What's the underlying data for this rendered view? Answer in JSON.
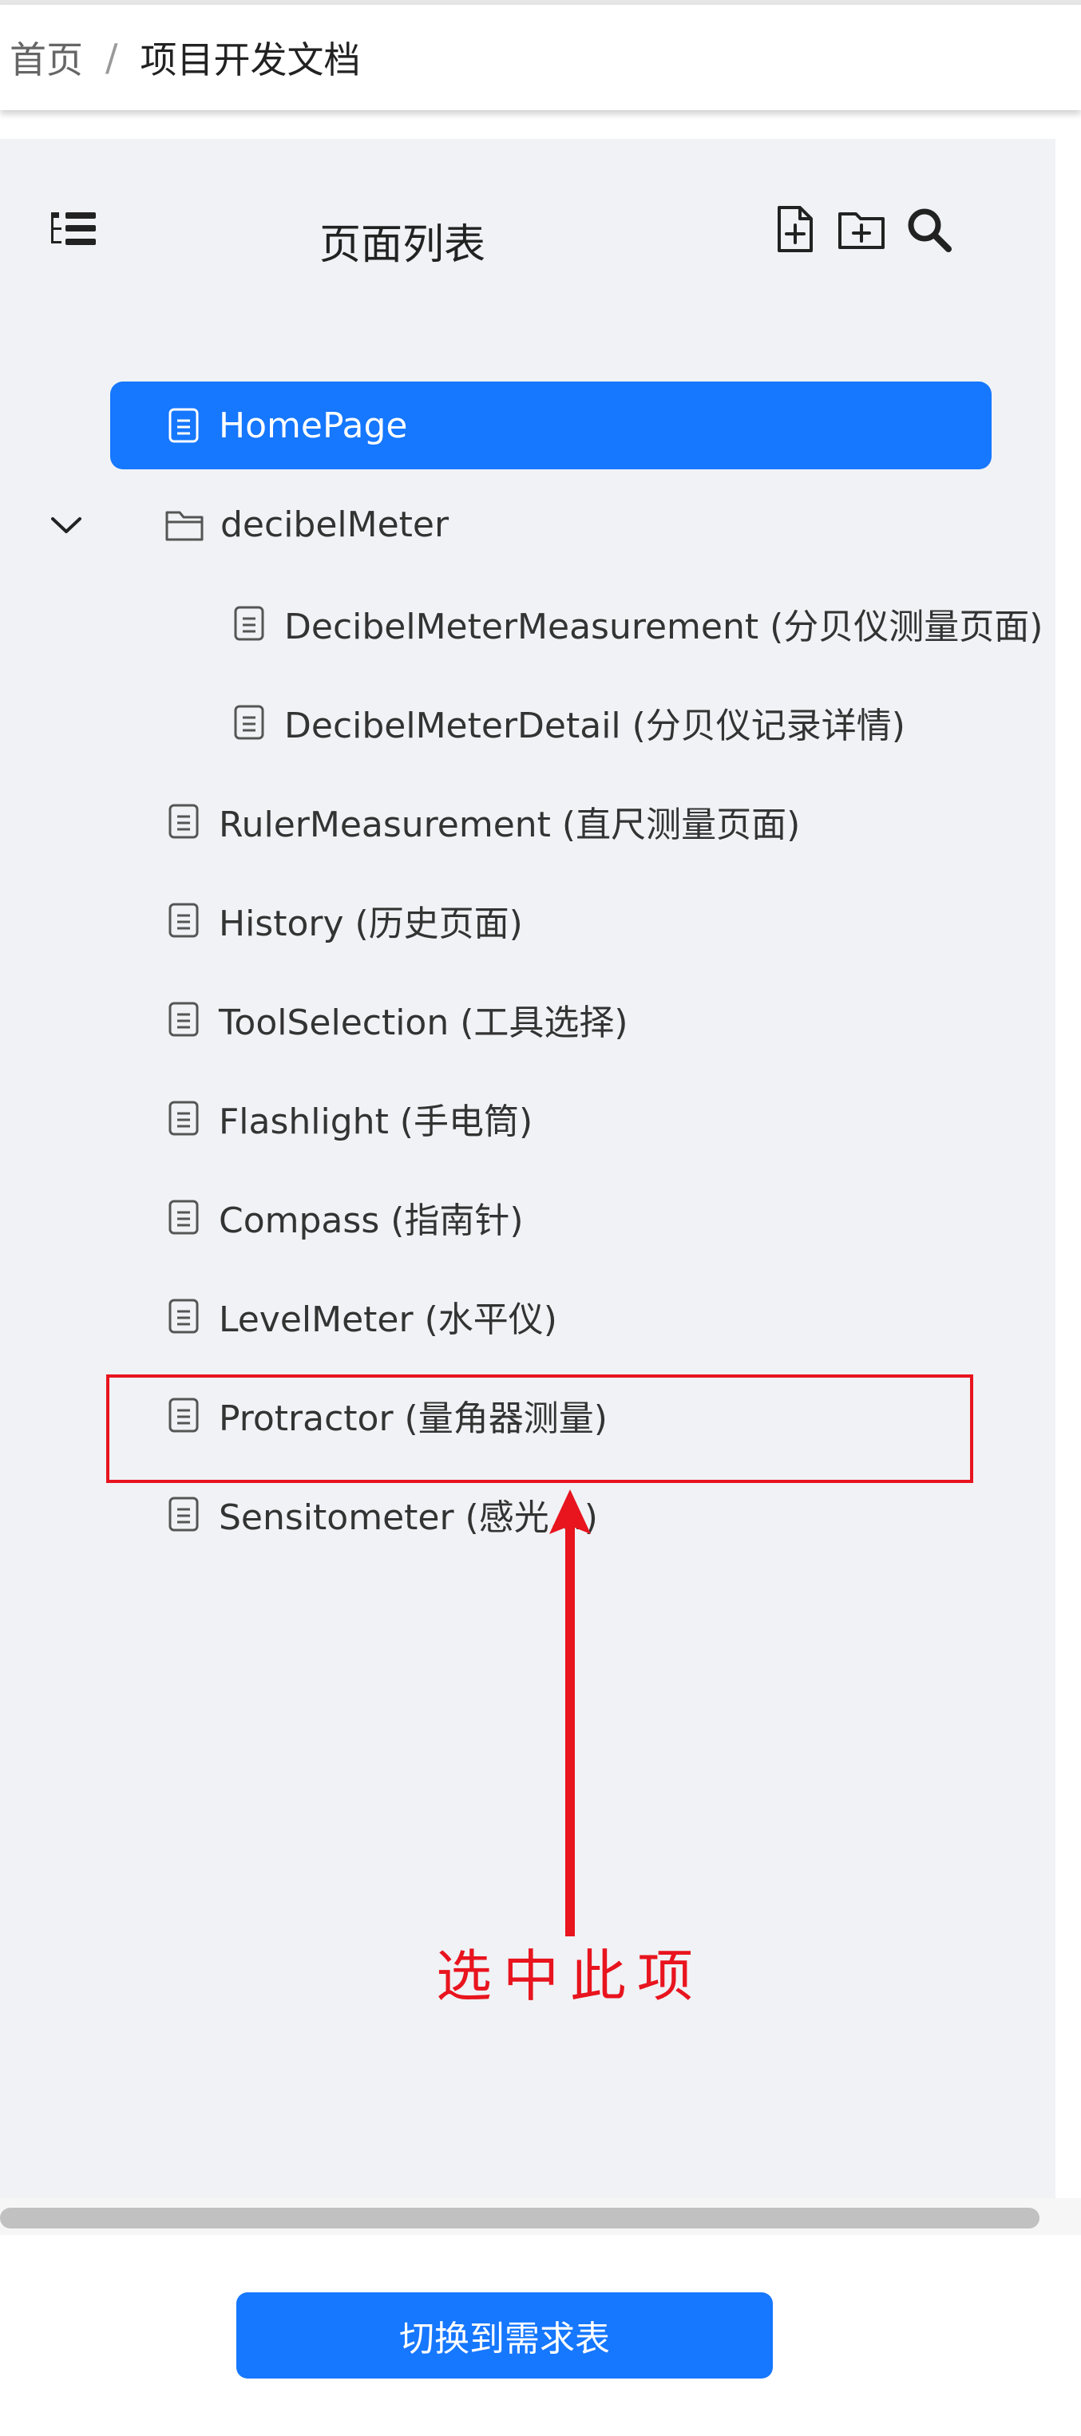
{
  "breadcrumb": {
    "home": "首页",
    "separator": "/",
    "current": "项目开发文档"
  },
  "panel": {
    "title": "页面列表",
    "actions": [
      "add-file-icon",
      "add-folder-icon",
      "search-icon"
    ]
  },
  "tree": {
    "items": [
      {
        "label": "HomePage",
        "type": "page",
        "depth": 0,
        "selected": true
      },
      {
        "label": "decibelMeter",
        "type": "folder",
        "depth": 0,
        "expanded": true
      },
      {
        "label": "DecibelMeterMeasurement (分贝仪测量页面)",
        "type": "page",
        "depth": 1
      },
      {
        "label": "DecibelMeterDetail (分贝仪记录详情)",
        "type": "page",
        "depth": 1
      },
      {
        "label": "RulerMeasurement (直尺测量页面)",
        "type": "page",
        "depth": 0
      },
      {
        "label": "History (历史页面)",
        "type": "page",
        "depth": 0
      },
      {
        "label": "ToolSelection (工具选择)",
        "type": "page",
        "depth": 0
      },
      {
        "label": "Flashlight (手电筒)",
        "type": "page",
        "depth": 0
      },
      {
        "label": "Compass (指南针)",
        "type": "page",
        "depth": 0
      },
      {
        "label": "LevelMeter (水平仪)",
        "type": "page",
        "depth": 0
      },
      {
        "label": "Protractor (量角器测量)",
        "type": "page",
        "depth": 0
      },
      {
        "label": "Sensitometer (感光…)",
        "type": "page",
        "depth": 0
      }
    ]
  },
  "footer": {
    "switch_label": "切换到需求表"
  },
  "annotation": {
    "text": "选中此项"
  },
  "colors": {
    "accent": "#1677ff",
    "annotation": "#e8141e",
    "panel_bg": "#f0f2f5"
  }
}
